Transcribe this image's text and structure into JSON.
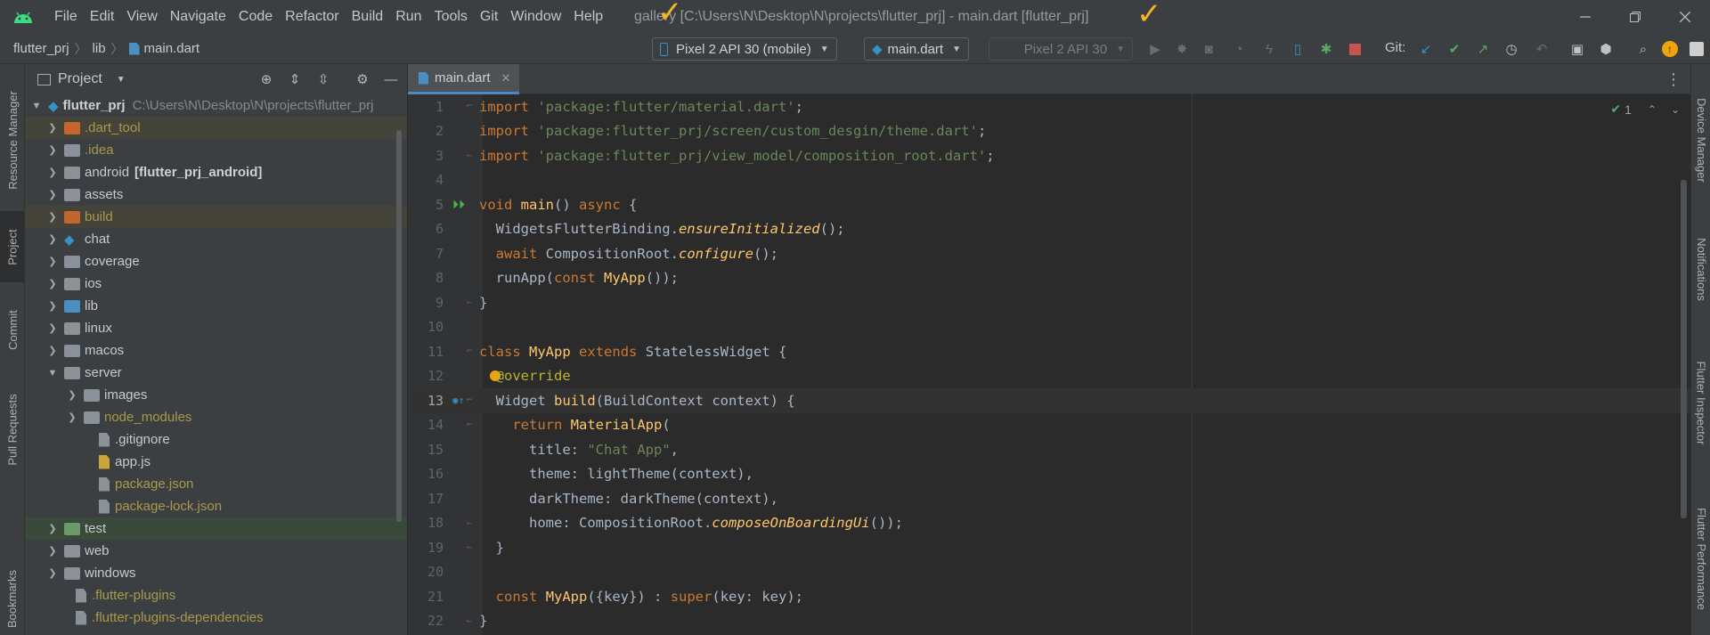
{
  "menubar": {
    "items": [
      "File",
      "Edit",
      "View",
      "Navigate",
      "Code",
      "Refactor",
      "Build",
      "Run",
      "Tools",
      "Git",
      "Window",
      "Help"
    ],
    "window_title": "gallery [C:\\Users\\N\\Desktop\\N\\projects\\flutter_prj] - main.dart [flutter_prj]"
  },
  "breadcrumb": {
    "project": "flutter_prj",
    "folder": "lib",
    "file": "main.dart"
  },
  "toolbar": {
    "device_selector": "Pixel 2 API 30 (mobile)",
    "run_config": "main.dart",
    "disabled_device": "Pixel 2 API 30",
    "git_label": "Git:"
  },
  "left_strip": {
    "tabs": [
      "Resource Manager",
      "Project",
      "Commit",
      "Pull Requests",
      "Bookmarks"
    ]
  },
  "right_strip": {
    "tabs": [
      "Device Manager",
      "Notifications",
      "Flutter Inspector",
      "Flutter Performance"
    ]
  },
  "project_panel": {
    "title": "Project",
    "root": {
      "name": "flutter_prj",
      "path": "C:\\Users\\N\\Desktop\\N\\projects\\flutter_prj"
    },
    "items": [
      {
        "label": ".dart_tool",
        "kind": "folder-excluded"
      },
      {
        "label": ".idea",
        "kind": "folder-idea"
      },
      {
        "label": "android",
        "extra": "[flutter_prj_android]",
        "kind": "folder"
      },
      {
        "label": "assets",
        "kind": "folder"
      },
      {
        "label": "build",
        "kind": "folder-excluded"
      },
      {
        "label": "chat",
        "kind": "flutter"
      },
      {
        "label": "coverage",
        "kind": "folder"
      },
      {
        "label": "ios",
        "kind": "folder"
      },
      {
        "label": "lib",
        "kind": "folder-source"
      },
      {
        "label": "linux",
        "kind": "folder"
      },
      {
        "label": "macos",
        "kind": "folder"
      },
      {
        "label": "server",
        "kind": "folder-open"
      },
      {
        "label": "images",
        "kind": "folder"
      },
      {
        "label": "node_modules",
        "kind": "folder-ignored"
      },
      {
        "label": ".gitignore",
        "kind": "file"
      },
      {
        "label": "app.js",
        "kind": "file-js"
      },
      {
        "label": "package.json",
        "kind": "file-ignored"
      },
      {
        "label": "package-lock.json",
        "kind": "file-ignored"
      },
      {
        "label": "test",
        "kind": "folder-test"
      },
      {
        "label": "web",
        "kind": "folder"
      },
      {
        "label": "windows",
        "kind": "folder"
      },
      {
        "label": ".flutter-plugins",
        "kind": "file-ignored"
      },
      {
        "label": ".flutter-plugins-dependencies",
        "kind": "file-ignored"
      }
    ]
  },
  "editor": {
    "tab": "main.dart",
    "inspection_count": "1",
    "lines": [
      {
        "n": "1",
        "text": "import 'package:flutter/material.dart';"
      },
      {
        "n": "2",
        "text": "import 'package:flutter_prj/screen/custom_desgin/theme.dart';"
      },
      {
        "n": "3",
        "text": "import 'package:flutter_prj/view_model/composition_root.dart';"
      },
      {
        "n": "4",
        "text": ""
      },
      {
        "n": "5",
        "text": "void main() async {"
      },
      {
        "n": "6",
        "text": "  WidgetsFlutterBinding.ensureInitialized();"
      },
      {
        "n": "7",
        "text": "  await CompositionRoot.configure();"
      },
      {
        "n": "8",
        "text": "  runApp(const MyApp());"
      },
      {
        "n": "9",
        "text": "}"
      },
      {
        "n": "10",
        "text": ""
      },
      {
        "n": "11",
        "text": "class MyApp extends StatelessWidget {"
      },
      {
        "n": "12",
        "text": "  @override"
      },
      {
        "n": "13",
        "text": "  Widget build(BuildContext context) {"
      },
      {
        "n": "14",
        "text": "    return MaterialApp("
      },
      {
        "n": "15",
        "text": "      title: \"Chat App\","
      },
      {
        "n": "16",
        "text": "      theme: lightTheme(context),"
      },
      {
        "n": "17",
        "text": "      darkTheme: darkTheme(context),"
      },
      {
        "n": "18",
        "text": "      home: CompositionRoot.composeOnBoardingUi());"
      },
      {
        "n": "19",
        "text": "  }"
      },
      {
        "n": "20",
        "text": ""
      },
      {
        "n": "21",
        "text": "  const MyApp({key}) : super(key: key);"
      },
      {
        "n": "22",
        "text": "}"
      }
    ]
  },
  "colors": {
    "accent_blue": "#4a88c7",
    "check_annotation": "#f3b623",
    "keyword": "#cc7832",
    "string": "#6a8759",
    "function": "#ffc66d"
  },
  "icons": [
    "android-logo-icon",
    "device-phone-icon",
    "run-icon",
    "debug-icon",
    "profile-icon",
    "stop-icon",
    "git-update-icon",
    "git-commit-icon",
    "git-push-icon",
    "history-icon",
    "rollback-icon",
    "search-icon",
    "update-icon",
    "settings-icon"
  ]
}
